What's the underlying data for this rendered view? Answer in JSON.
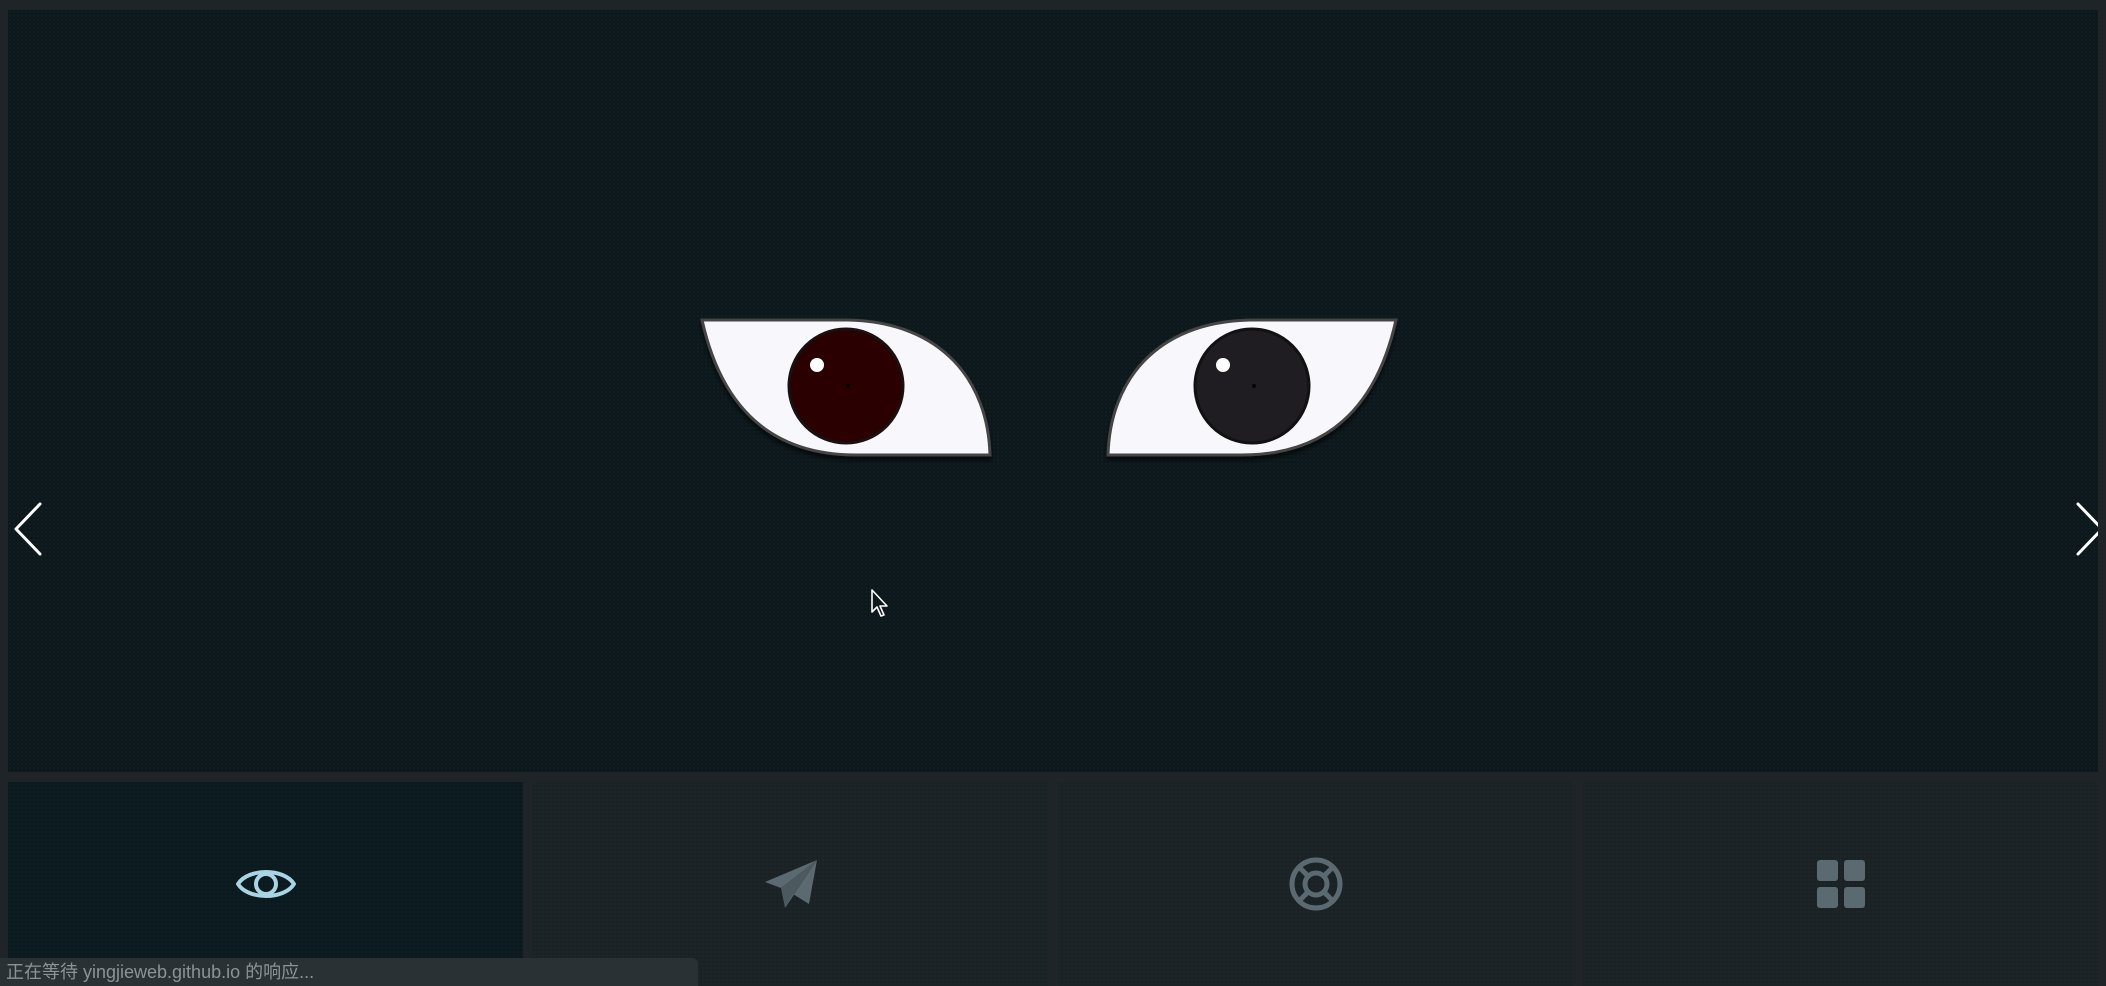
{
  "slider": {
    "prev_icon": "chevron-left-icon",
    "next_icon": "chevron-right-icon",
    "left_iris_color": "#2b0000",
    "right_iris_color": "#1f1d22",
    "sclera_color": "#f8f8fc"
  },
  "tabs": [
    {
      "icon": "eye-icon",
      "active": true
    },
    {
      "icon": "paper-plane-icon",
      "active": false
    },
    {
      "icon": "lifebuoy-icon",
      "active": false
    },
    {
      "icon": "grid-icon",
      "active": false
    }
  ],
  "colors": {
    "background": "#0c181c",
    "active_icon": "#a9d4e4",
    "inactive_icon": "#5b6a70"
  },
  "status": {
    "text": "正在等待 yingjieweb.github.io 的响应..."
  }
}
